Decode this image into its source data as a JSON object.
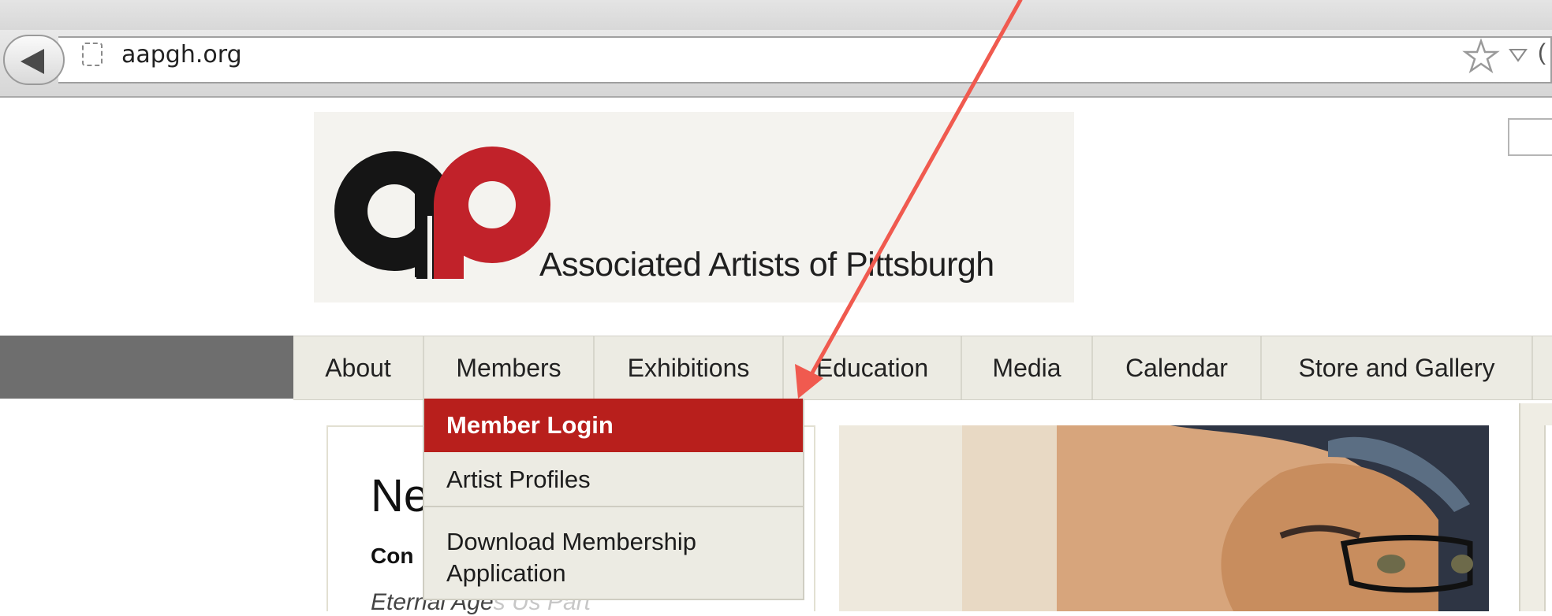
{
  "browser": {
    "url": "aapgh.org",
    "icons": [
      "back-arrow-icon",
      "page-placeholder-icon",
      "star-icon",
      "dropdown-caret-icon"
    ]
  },
  "site": {
    "logo_letters": "ap",
    "name": "Associated Artists of Pittsburgh",
    "brand_colors": {
      "red": "#c1222a",
      "black": "#151515",
      "menu_active": "#b81f1c"
    }
  },
  "nav": {
    "items": [
      {
        "label": "About"
      },
      {
        "label": "Members"
      },
      {
        "label": "Exhibitions"
      },
      {
        "label": "Education"
      },
      {
        "label": "Media"
      },
      {
        "label": "Calendar"
      },
      {
        "label": "Store and Gallery"
      }
    ]
  },
  "members_menu": {
    "items": [
      {
        "label": "Member Login",
        "active": true
      },
      {
        "label": "Artist Profiles",
        "active": false
      },
      {
        "label_line1": "Download Membership",
        "label_line2": "Application",
        "active": false
      }
    ]
  },
  "content": {
    "heading_partial": "Ne",
    "subheading_partial": "Con",
    "italic_partial": "Eternal Age",
    "italic_faded_partial": "s Us Part"
  },
  "annotation": {
    "type": "arrow",
    "color": "#f05a4f",
    "points_to": "Member Login"
  }
}
